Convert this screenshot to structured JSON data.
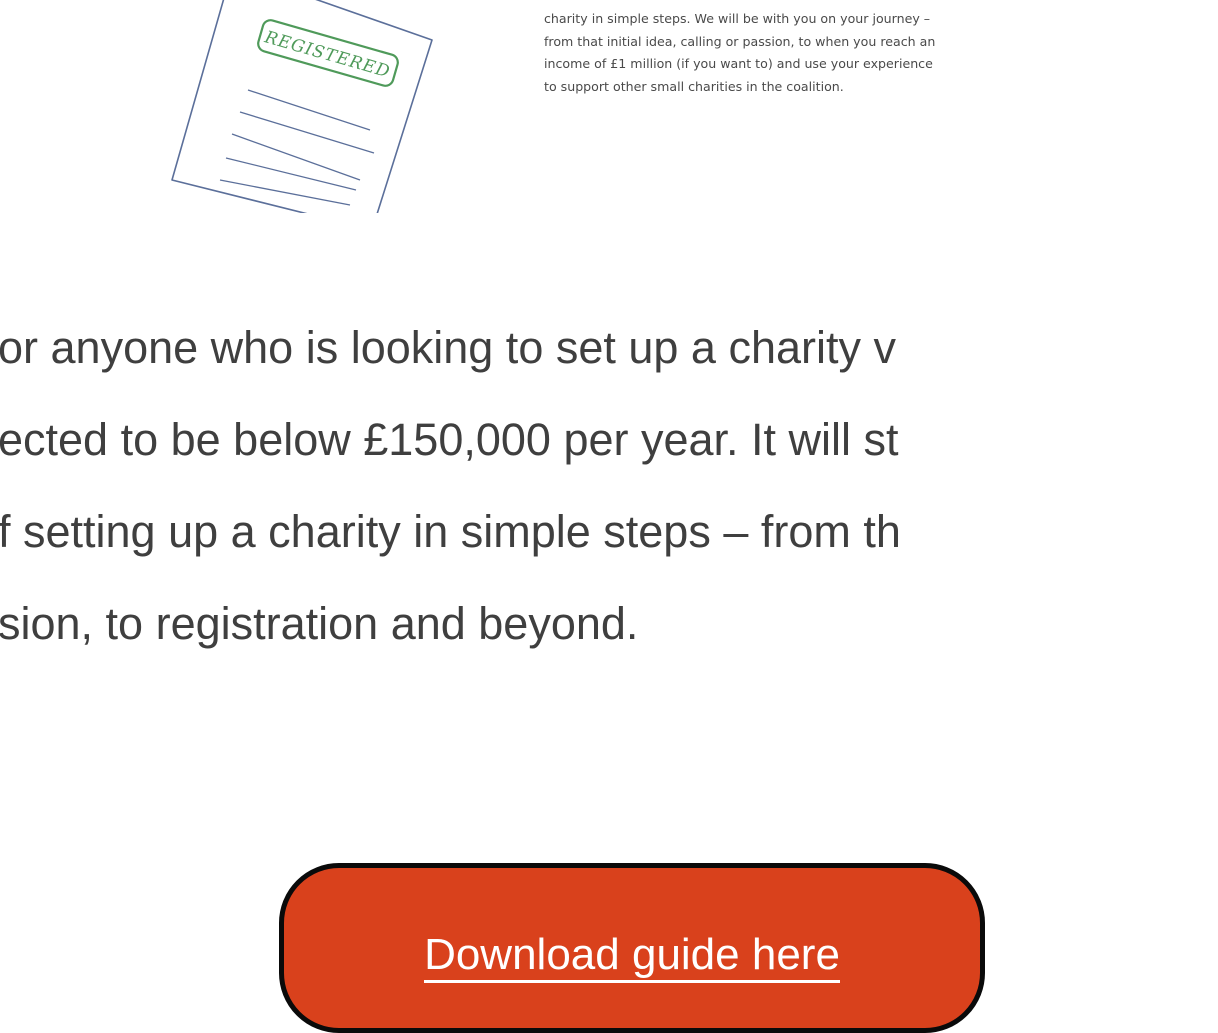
{
  "cover": {
    "stamp_text": "REGISTERED",
    "text_lines": [
      "charity in simple steps. We will be with you on your journey –",
      "from that initial idea, calling or passion, to when you reach an",
      "income of £1 million (if you want to) and use your experience",
      "to support other small charities in the coalition."
    ]
  },
  "intro": {
    "lines": [
      "or anyone who is looking to set up a charity v",
      "ected to be below £150,000 per year. It will st",
      "f setting up a charity in simple steps – from th",
      "sion, to registration and beyond."
    ]
  },
  "download": {
    "label": "Download guide here"
  },
  "colors": {
    "button_fill": "#d9411c",
    "button_border": "#0a0a0a",
    "text": "#3f3f3f",
    "stamp": "#4f9a5a",
    "sketch": "#5b6f9a"
  }
}
